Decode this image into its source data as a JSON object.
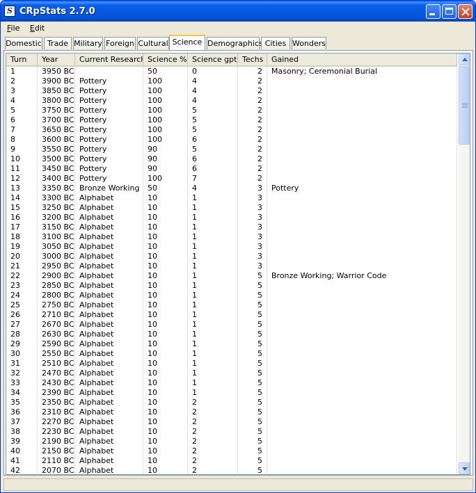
{
  "window": {
    "title": "CRpStats 2.7.0"
  },
  "menu": [
    "File",
    "Edit"
  ],
  "tabs": [
    "Domestic",
    "Trade",
    "Military",
    "Foreign",
    "Cultural",
    "Science",
    "Demographics",
    "Cities",
    "Wonders"
  ],
  "active_tab": "Science",
  "table": {
    "columns": [
      "Turn",
      "Year",
      "Current Research",
      "Science %",
      "Science gpt",
      "Techs",
      "Gained"
    ],
    "rows": [
      [
        "1",
        "3950 BC",
        "",
        "50",
        "0",
        "2",
        "Masonry; Ceremonial Burial"
      ],
      [
        "2",
        "3900 BC",
        "Pottery",
        "100",
        "4",
        "2",
        ""
      ],
      [
        "3",
        "3850 BC",
        "Pottery",
        "100",
        "4",
        "2",
        ""
      ],
      [
        "4",
        "3800 BC",
        "Pottery",
        "100",
        "4",
        "2",
        ""
      ],
      [
        "5",
        "3750 BC",
        "Pottery",
        "100",
        "5",
        "2",
        ""
      ],
      [
        "6",
        "3700 BC",
        "Pottery",
        "100",
        "5",
        "2",
        ""
      ],
      [
        "7",
        "3650 BC",
        "Pottery",
        "100",
        "5",
        "2",
        ""
      ],
      [
        "8",
        "3600 BC",
        "Pottery",
        "100",
        "6",
        "2",
        ""
      ],
      [
        "9",
        "3550 BC",
        "Pottery",
        "90",
        "5",
        "2",
        ""
      ],
      [
        "10",
        "3500 BC",
        "Pottery",
        "90",
        "6",
        "2",
        ""
      ],
      [
        "11",
        "3450 BC",
        "Pottery",
        "90",
        "6",
        "2",
        ""
      ],
      [
        "12",
        "3400 BC",
        "Pottery",
        "100",
        "7",
        "2",
        ""
      ],
      [
        "13",
        "3350 BC",
        "Bronze Working",
        "50",
        "4",
        "3",
        "Pottery"
      ],
      [
        "14",
        "3300 BC",
        "Alphabet",
        "10",
        "1",
        "3",
        ""
      ],
      [
        "15",
        "3250 BC",
        "Alphabet",
        "10",
        "1",
        "3",
        ""
      ],
      [
        "16",
        "3200 BC",
        "Alphabet",
        "10",
        "1",
        "3",
        ""
      ],
      [
        "17",
        "3150 BC",
        "Alphabet",
        "10",
        "1",
        "3",
        ""
      ],
      [
        "18",
        "3100 BC",
        "Alphabet",
        "10",
        "1",
        "3",
        ""
      ],
      [
        "19",
        "3050 BC",
        "Alphabet",
        "10",
        "1",
        "3",
        ""
      ],
      [
        "20",
        "3000 BC",
        "Alphabet",
        "10",
        "1",
        "3",
        ""
      ],
      [
        "21",
        "2950 BC",
        "Alphabet",
        "10",
        "1",
        "3",
        ""
      ],
      [
        "22",
        "2900 BC",
        "Alphabet",
        "10",
        "1",
        "5",
        "Bronze Working; Warrior Code"
      ],
      [
        "23",
        "2850 BC",
        "Alphabet",
        "10",
        "1",
        "5",
        ""
      ],
      [
        "24",
        "2800 BC",
        "Alphabet",
        "10",
        "1",
        "5",
        ""
      ],
      [
        "25",
        "2750 BC",
        "Alphabet",
        "10",
        "1",
        "5",
        ""
      ],
      [
        "26",
        "2710 BC",
        "Alphabet",
        "10",
        "1",
        "5",
        ""
      ],
      [
        "27",
        "2670 BC",
        "Alphabet",
        "10",
        "1",
        "5",
        ""
      ],
      [
        "28",
        "2630 BC",
        "Alphabet",
        "10",
        "1",
        "5",
        ""
      ],
      [
        "29",
        "2590 BC",
        "Alphabet",
        "10",
        "1",
        "5",
        ""
      ],
      [
        "30",
        "2550 BC",
        "Alphabet",
        "10",
        "1",
        "5",
        ""
      ],
      [
        "31",
        "2510 BC",
        "Alphabet",
        "10",
        "1",
        "5",
        ""
      ],
      [
        "32",
        "2470 BC",
        "Alphabet",
        "10",
        "1",
        "5",
        ""
      ],
      [
        "33",
        "2430 BC",
        "Alphabet",
        "10",
        "1",
        "5",
        ""
      ],
      [
        "34",
        "2390 BC",
        "Alphabet",
        "10",
        "1",
        "5",
        ""
      ],
      [
        "35",
        "2350 BC",
        "Alphabet",
        "10",
        "2",
        "5",
        ""
      ],
      [
        "36",
        "2310 BC",
        "Alphabet",
        "10",
        "2",
        "5",
        ""
      ],
      [
        "37",
        "2270 BC",
        "Alphabet",
        "10",
        "2",
        "5",
        ""
      ],
      [
        "38",
        "2230 BC",
        "Alphabet",
        "10",
        "2",
        "5",
        ""
      ],
      [
        "39",
        "2190 BC",
        "Alphabet",
        "10",
        "2",
        "5",
        ""
      ],
      [
        "40",
        "2150 BC",
        "Alphabet",
        "10",
        "2",
        "5",
        ""
      ],
      [
        "41",
        "2110 BC",
        "Alphabet",
        "10",
        "2",
        "5",
        ""
      ],
      [
        "42",
        "2070 BC",
        "Alphabet",
        "10",
        "2",
        "5",
        ""
      ]
    ]
  }
}
